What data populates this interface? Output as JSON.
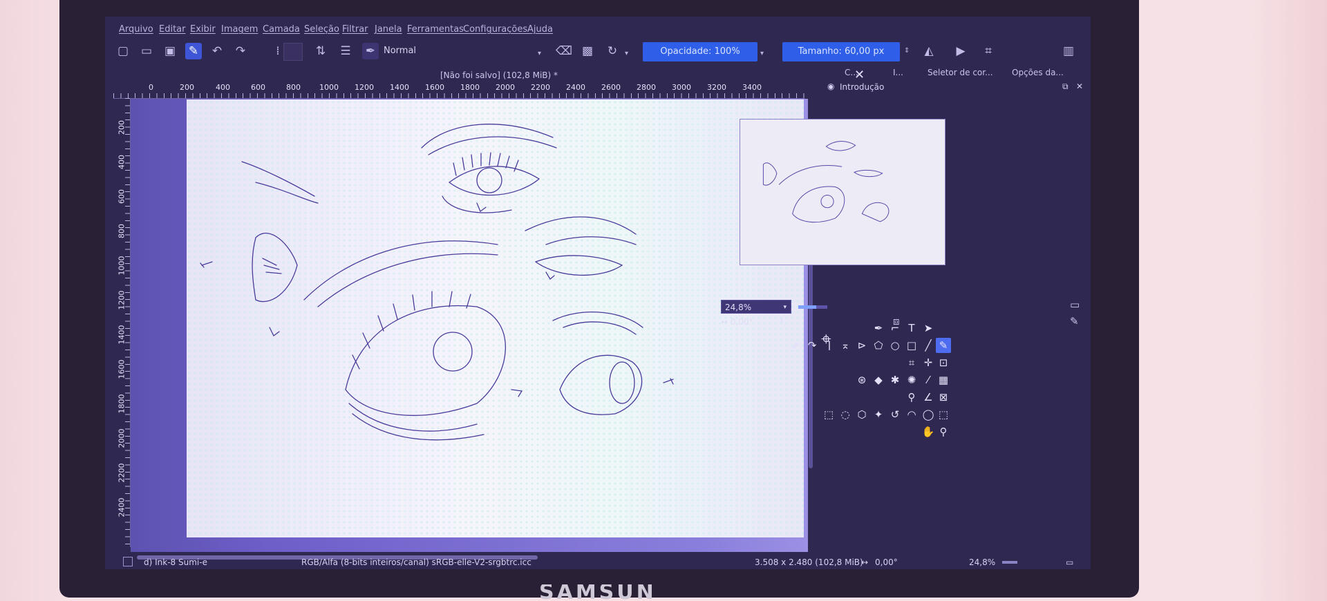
{
  "menu": {
    "items": [
      "Arquivo",
      "Editar",
      "Exibir",
      "Imagem",
      "Camada",
      "Seleção",
      "Filtrar",
      "Janela",
      "Ferramentas",
      "Configurações",
      "Ajuda"
    ]
  },
  "toolbar": {
    "blend_mode": "Normal",
    "opacity_label": "Opacidade: 100%",
    "size_label": "Tamanho: 60,00 px"
  },
  "document": {
    "title": "[Não foi salvo]  (102,8 MiB) *"
  },
  "rulers": {
    "horizontal": [
      "0",
      "200",
      "400",
      "600",
      "800",
      "1000",
      "1200",
      "1400",
      "1600",
      "1800",
      "2000",
      "2200",
      "2400",
      "2600",
      "2800",
      "3000",
      "3200",
      "3400"
    ],
    "vertical": [
      "200",
      "400",
      "600",
      "800",
      "1000",
      "1200",
      "1400",
      "1600",
      "1800",
      "2000",
      "2200",
      "2400"
    ]
  },
  "docker": {
    "tabs": [
      "C...",
      "I...",
      "Seletor de cor...",
      "Opções da..."
    ],
    "overview_title": "Introdução",
    "zoom": "24,8%",
    "rotation": "0,00°"
  },
  "statusbar": {
    "brush": "d) Ink-8 Sumi-e",
    "color_profile": "RGB/Alfa (8-bits inteiros/canal)  sRGB-elle-V2-srgbtrc.icc",
    "dimensions": "3.508 x 2.480 (102,8 MiB)",
    "rotation": "0,00°",
    "zoom": "24,8%"
  },
  "laptop": {
    "brand": "SAMSUNG"
  },
  "icons": [
    "new-document-icon",
    "open-icon",
    "save-icon",
    "brush-icon",
    "undo-icon",
    "redo-icon",
    "eraser-icon",
    "alpha-lock-icon",
    "reload-icon",
    "mirror-horizontal-icon",
    "mirror-vertical-icon",
    "crop-icon",
    "close-icon"
  ]
}
